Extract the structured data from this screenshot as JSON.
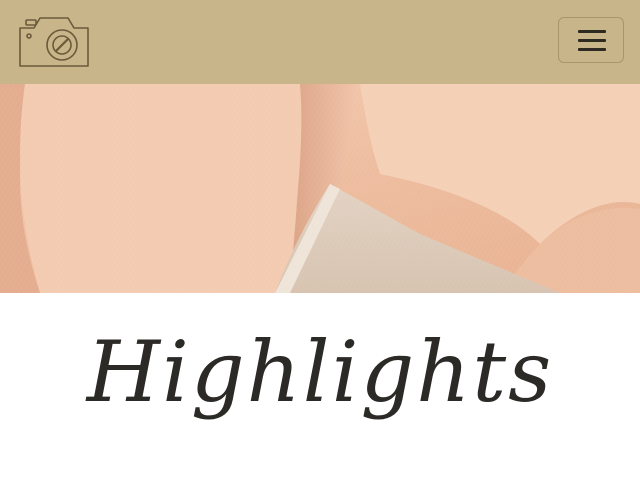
{
  "navbar": {
    "background": "#c8b68a",
    "logo_icon": "camera-icon",
    "menu_icon": "hamburger-menu-icon"
  },
  "hero": {
    "image": "peach-linen-fabric-folds",
    "colors": [
      "#f2c7ad",
      "#e8b899",
      "#d9c7b4"
    ]
  },
  "section": {
    "heading": "Highlights"
  }
}
